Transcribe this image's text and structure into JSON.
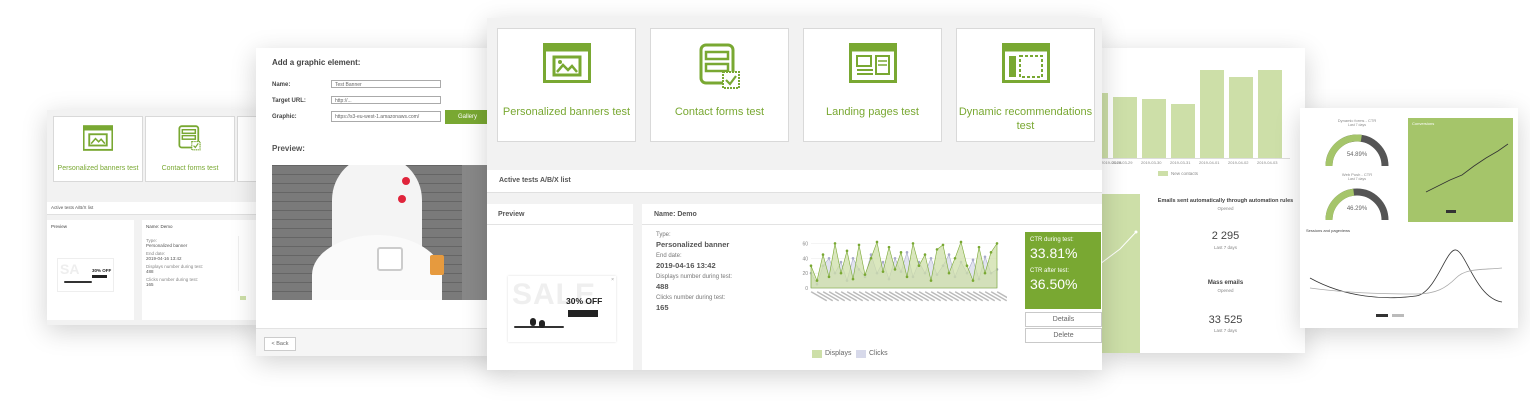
{
  "main": {
    "tiles": [
      {
        "label": "Personalized banners test",
        "icon": "banner-icon"
      },
      {
        "label": "Contact forms test",
        "icon": "form-icon"
      },
      {
        "label": "Landing pages test",
        "icon": "landing-page-icon"
      },
      {
        "label": "Dynamic recommendations test",
        "icon": "recommendations-icon"
      }
    ],
    "list_title": "Active tests A/B/X list",
    "preview_title": "Preview",
    "test_name": "Name: Demo",
    "type_label": "Type:",
    "type_value": "Personalized banner",
    "end_label": "End date:",
    "end_value": "2019-04-16 13:42",
    "displays_label": "Displays number during test:",
    "displays_value": "488",
    "clicks_label": "Clicks number during test:",
    "clicks_value": "165",
    "ctr_during_label": "CTR during test:",
    "ctr_during_value": "33.81%",
    "ctr_after_label": "CTR after test:",
    "ctr_after_value": "36.50%",
    "details_button": "Details",
    "delete_button": "Delete",
    "banner_sale": "SALE",
    "banner_off": "30% OFF"
  },
  "form": {
    "title": "Add a graphic element:",
    "name_label": "Name:",
    "name_value": "Test Banner",
    "url_label": "Target URL:",
    "url_value": "http://...",
    "graphic_label": "Graphic:",
    "graphic_value": "https://s3-eu-west-1.amazonaws.com/",
    "gallery_button": "Gallery",
    "preview_label": "Preview:",
    "back_button": "< Back"
  },
  "left": {
    "tiles": [
      {
        "label": "Personalized banners test"
      },
      {
        "label": "Contact forms test"
      }
    ],
    "list_title": "Active tests A/B/X list",
    "preview_title": "Preview",
    "name": "Name: Demo",
    "type_label": "Type:",
    "type_value": "Personalized banner",
    "end_label": "End date:",
    "end_value": "2019-04-16 13:42",
    "displays_label": "Displays number during test:",
    "displays_value": "488",
    "clicks_label": "Clicks number during test:",
    "clicks_value": "165",
    "banner_off": "30% OFF"
  },
  "right1": {
    "bar_labels": [
      "2019-03-28",
      "2019-03-29",
      "2019-03-30",
      "2019-03-31",
      "2019-04-01",
      "2019-04-02",
      "2019-04-03"
    ],
    "legend": "New contacts",
    "auto_title": "Emails sent automatically through automation rules",
    "auto_sub": "Opened",
    "auto_value": "2 295",
    "auto_period": "Last 7 days",
    "mass_title": "Mass emails",
    "mass_sub": "Opened",
    "mass_value": "33 525",
    "mass_period": "Last 7 days"
  },
  "right2": {
    "gauge1_title": "Dynamic forms - CTR",
    "gauge1_sub": "Last 7 days",
    "gauge1_value": "54.89%",
    "gauge1_fraction": 0.5489,
    "gauge2_title": "Web Push - CTR",
    "gauge2_sub": "Last 7 days",
    "gauge2_value": "46.29%",
    "gauge2_fraction": 0.4629,
    "line_title": "Conversions",
    "bottom_title": "Sessions and pageviews"
  },
  "colors": {
    "accent": "#79a832",
    "accent_light": "#cddfa8",
    "clicks": "#d7d9ea",
    "gray": "#555555"
  }
}
